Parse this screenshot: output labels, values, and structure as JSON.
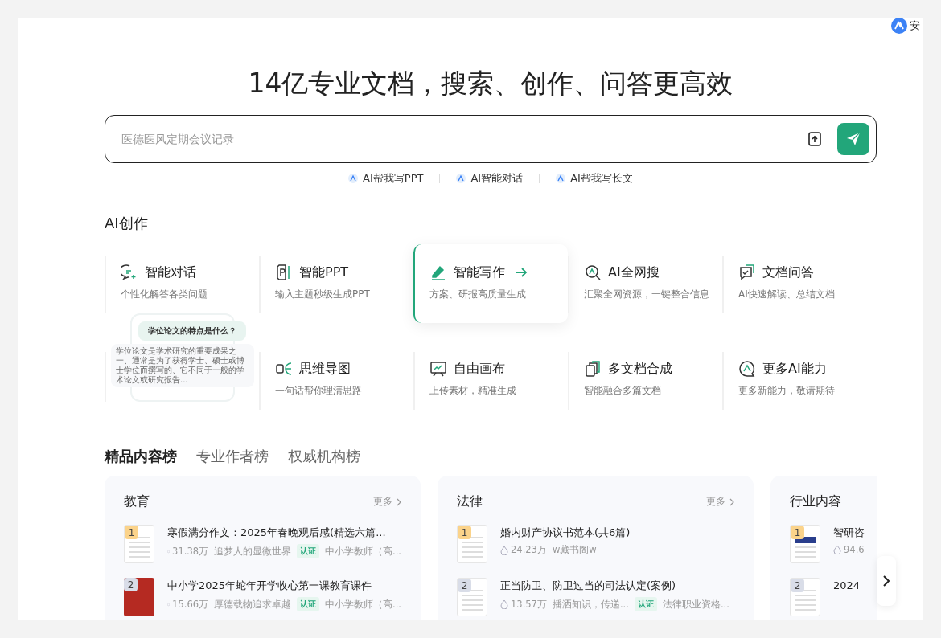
{
  "install": {
    "label": "安"
  },
  "headline": "14亿专业文档，搜索、创作、问答更高效",
  "search": {
    "placeholder": "医德医风定期会议记录"
  },
  "quick_links": [
    "AI帮我写PPT",
    "AI智能对话",
    "AI帮我写长文"
  ],
  "ai_section": {
    "title": "AI创作",
    "illustration": {
      "question": "学位论文的特点是什么？",
      "answer": "学位论文是学术研究的重要成果之一、通常是为了获得学士、硕士或博士学位而撰写的、它不同于一般的学术论文或研究报告..."
    },
    "features": [
      {
        "title": "智能对话",
        "desc": "个性化解答各类问题",
        "selected": false
      },
      {
        "title": "智能PPT",
        "desc": "输入主题秒级生成PPT",
        "selected": false
      },
      {
        "title": "智能写作",
        "desc": "方案、研报高质量生成",
        "selected": true
      },
      {
        "title": "AI全网搜",
        "desc": "汇聚全网资源，一键整合信息",
        "selected": false
      },
      {
        "title": "文档问答",
        "desc": "AI快速解读、总结文档",
        "selected": false
      },
      {
        "title": "思维导图",
        "desc": "一句话帮你理清思路",
        "selected": false
      },
      {
        "title": "自由画布",
        "desc": "上传素材，精准生成",
        "selected": false
      },
      {
        "title": "多文档合成",
        "desc": "智能融合多篇文档",
        "selected": false
      },
      {
        "title": "更多AI能力",
        "desc": "更多新能力，敬请期待",
        "selected": false
      }
    ]
  },
  "ranking_tabs": [
    {
      "label": "精品内容榜",
      "selected": true
    },
    {
      "label": "专业作者榜",
      "selected": false
    },
    {
      "label": "权威机构榜",
      "selected": false
    }
  ],
  "cards": [
    {
      "title": "教育",
      "more": "更多",
      "items": [
        {
          "rank": "1",
          "kind": "doc",
          "title": "寒假满分作文：2025年春晚观后感(精选六篇...",
          "views": "31.38万",
          "author": "追梦人的显微世界",
          "tag": "认证",
          "role": "中小学教师（高..."
        },
        {
          "rank": "2",
          "kind": "photo",
          "title": "中小学2025年蛇年开学收心第一课教育课件",
          "views": "15.66万",
          "author": "厚德载物追求卓越",
          "tag": "认证",
          "role": "中小学教师（高..."
        }
      ]
    },
    {
      "title": "法律",
      "more": "更多",
      "items": [
        {
          "rank": "1",
          "kind": "doc",
          "title": "婚内财产协议书范本(共6篇)",
          "views": "24.23万",
          "author": "w藏书阁w"
        },
        {
          "rank": "2",
          "kind": "doc",
          "title": "正当防卫、防卫过当的司法认定(案例)",
          "views": "13.57万",
          "author": "播洒知识，传递...",
          "tag": "认证",
          "role": "法律职业资格..."
        }
      ]
    },
    {
      "title": "行业内容",
      "items": [
        {
          "rank": "1",
          "kind": "report",
          "title": "智研咨",
          "views": "94.6"
        },
        {
          "rank": "2",
          "kind": "doc",
          "title": "2024"
        }
      ]
    }
  ]
}
